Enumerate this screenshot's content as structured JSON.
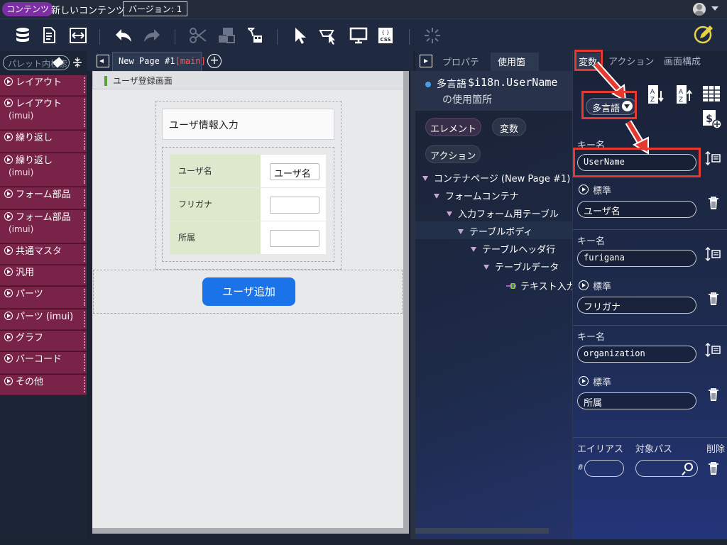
{
  "topbar": {
    "badge": "コンテンツ",
    "title": "新しいコンテンツ",
    "version": "バージョン: 1"
  },
  "palette": {
    "search_placeholder": "パレット内検索",
    "items": [
      {
        "label": "レイアウト",
        "sub": ""
      },
      {
        "label": "レイアウト",
        "sub": "(imui)"
      },
      {
        "label": "繰り返し",
        "sub": ""
      },
      {
        "label": "繰り返し",
        "sub": "(imui)"
      },
      {
        "label": "フォーム部品",
        "sub": ""
      },
      {
        "label": "フォーム部品",
        "sub": "(imui)"
      },
      {
        "label": "共通マスタ",
        "sub": ""
      },
      {
        "label": "汎用",
        "sub": ""
      },
      {
        "label": "パーツ",
        "sub": ""
      },
      {
        "label": "パーツ (imui)",
        "sub": ""
      },
      {
        "label": "グラフ",
        "sub": ""
      },
      {
        "label": "バーコード",
        "sub": ""
      },
      {
        "label": "その他",
        "sub": ""
      }
    ]
  },
  "canvas": {
    "tab_label": "New Page #1",
    "tab_suffix": "[main]",
    "screen_title": "ユーザ登録画面",
    "form_header": "ユーザ情報入力",
    "rows": [
      {
        "label": "ユーザ名",
        "value": "ユーザ名"
      },
      {
        "label": "フリガナ",
        "value": ""
      },
      {
        "label": "所属",
        "value": ""
      }
    ],
    "add_button": "ユーザ追加"
  },
  "middle": {
    "tabs": [
      "プロパティ",
      "使用箇所"
    ],
    "heading_prefix": "多言語",
    "heading_key": "$i18n.UserName",
    "heading_sub": "の使用箇所",
    "filters": [
      "エレメント",
      "変数",
      "アクション"
    ],
    "tree": [
      {
        "label": "コンテナページ (New Page #1)"
      },
      {
        "label": "フォームコンテナ"
      },
      {
        "label": "入力フォーム用テーブル"
      },
      {
        "label": "テーブルボディ"
      },
      {
        "label": "テーブルヘッダ行"
      },
      {
        "label": "テーブルデータ"
      },
      {
        "label": "テキスト入力"
      }
    ]
  },
  "right": {
    "tabs": [
      "変数",
      "アクション",
      "画面構成"
    ],
    "dropdown": "多言語",
    "key_label": "キー名",
    "standard_label": "標準",
    "entries": [
      {
        "key": "UserName",
        "value": "ユーザ名"
      },
      {
        "key": "furigana",
        "value": "フリガナ"
      },
      {
        "key": "organization",
        "value": "所属"
      }
    ],
    "alias_label": "エイリアス",
    "path_label": "対象パス",
    "delete_label": "削除",
    "hash": "#"
  },
  "colors": {
    "accent_red": "#e53a2f",
    "palette_bg": "#7a2348",
    "primary_button": "#1a73e8",
    "form_label_bg": "#dde8cc"
  }
}
